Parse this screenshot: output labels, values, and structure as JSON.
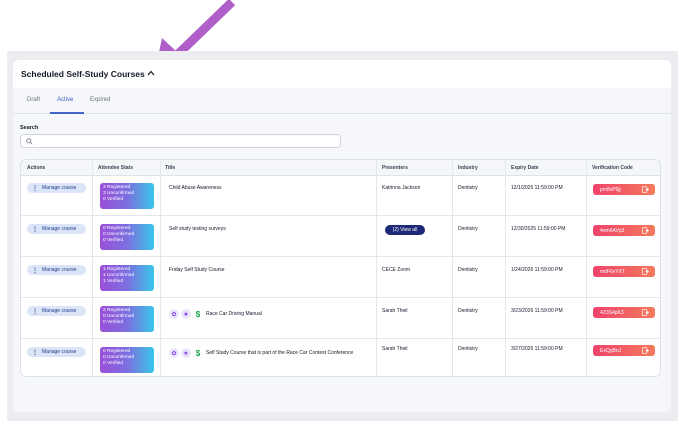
{
  "card": {
    "title": "Scheduled Self-Study Courses",
    "caret": "^"
  },
  "tabs": [
    {
      "label": "Draft"
    },
    {
      "label": "Active"
    },
    {
      "label": "Expired"
    }
  ],
  "search": {
    "label": "Search",
    "value": "",
    "placeholder": ""
  },
  "table": {
    "columns": [
      "Actions",
      "Attendee Stats",
      "Title",
      "Presenters",
      "Industry",
      "Expiry Date",
      "Verification Code"
    ],
    "rows": [
      {
        "action": "Manage course",
        "stats": [
          "3 Registered",
          "3 Unconfirmed",
          "0 Verified"
        ],
        "title": "Child Abuse Awareness",
        "presenter": "Katrinna Jackson",
        "industry": "Dentistry",
        "expiry": "12/1/2025 11:59:00 PM",
        "code": "pm8vP9jj"
      },
      {
        "action": "Manage course",
        "stats": [
          "0 Registered",
          "0 Unconfirmed",
          "0 Verified"
        ],
        "title": "Self study testing surveys",
        "presenter_button": "(2) View all",
        "industry": "Dentistry",
        "expiry": "12/30/2025 11:59:00 PM",
        "code": "4om6AVp3"
      },
      {
        "action": "Manage course",
        "stats": [
          "1 Registered",
          "1 Unconfirmed",
          "1 Verified"
        ],
        "title": "Friday Self Study Course",
        "presenter": "CECE Zoom",
        "industry": "Dentistry",
        "expiry": "1/24/2026 11:59:00 PM",
        "code": "mdF6vYXT"
      },
      {
        "action": "Manage course",
        "stats": [
          "2 Registered",
          "0 Unconfirmed",
          "0 Verified"
        ],
        "title": "Race Car Driving Manual",
        "presenter": "Sarah Thiel",
        "industry": "Dentistry",
        "expiry": "3/23/2026 11:59:00 PM",
        "code": "4Z3S4pK3"
      },
      {
        "action": "Manage course",
        "stats": [
          "0 Registered",
          "0 Unconfirmed",
          "0 Verified"
        ],
        "title": "Self Study Course that is part of the Race Car Contest Conference",
        "presenter": "Sarah Thiel",
        "industry": "Dentistry",
        "expiry": "3/27/2026 11:59:00 PM",
        "code": "ExQgBnJ"
      }
    ]
  },
  "colors": {
    "accent": "#3f63c7",
    "arrow": "#b05fc9",
    "code_gradient_start": "#f0436b",
    "code_gradient_end": "#f47a5c",
    "view_all": "#1e2a78"
  },
  "icons": [
    "search-icon",
    "caret-up-icon",
    "kebab-icon",
    "copy-icon",
    "badge-icon",
    "dollar-icon",
    "annotation-arrow"
  ]
}
